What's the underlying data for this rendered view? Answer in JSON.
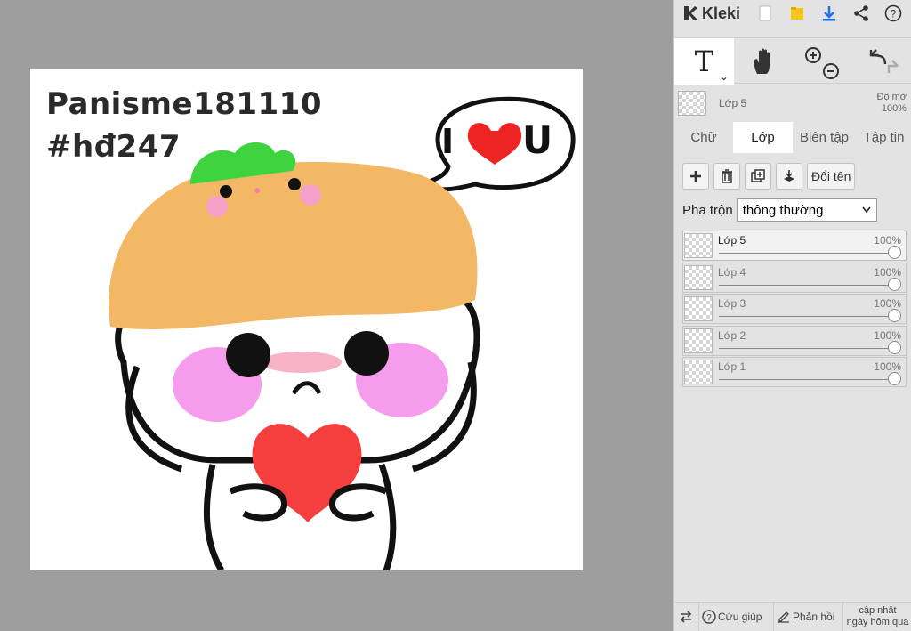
{
  "app": {
    "name": "Kleki"
  },
  "canvas": {
    "text_line1": "Panisme181110",
    "text_line2": "#hđ247",
    "speech_left": "I",
    "speech_right": "U"
  },
  "topbar": {
    "icons": [
      "new-image-icon",
      "open-folder-icon",
      "download-icon",
      "share-icon",
      "help-icon"
    ]
  },
  "tools": {
    "text_tool": "T",
    "dropdown": "⌄"
  },
  "current_layer": {
    "name": "Lớp 5",
    "opacity_label": "Độ mờ",
    "opacity_value": "100%"
  },
  "tabs": [
    "Chữ",
    "Lớp",
    "Biên tập",
    "Tập tin"
  ],
  "layer_actions": {
    "rename": "Đổi tên"
  },
  "blend": {
    "label": "Pha trộn",
    "value": "thông thường"
  },
  "layers": [
    {
      "name": "Lớp 5",
      "opacity": "100%",
      "selected": true
    },
    {
      "name": "Lớp 4",
      "opacity": "100%",
      "selected": false
    },
    {
      "name": "Lớp 3",
      "opacity": "100%",
      "selected": false
    },
    {
      "name": "Lớp 2",
      "opacity": "100%",
      "selected": false
    },
    {
      "name": "Lớp 1",
      "opacity": "100%",
      "selected": false
    }
  ],
  "bottombar": {
    "help": "Cứu giúp",
    "feedback": "Phản hồi",
    "update_line1": "cập nhật",
    "update_line2": "ngày hôm qua"
  },
  "colors": {
    "accent": "#1a73e8",
    "sidebar_bg": "#e3e3e3",
    "workspace_bg": "#9e9e9e"
  }
}
